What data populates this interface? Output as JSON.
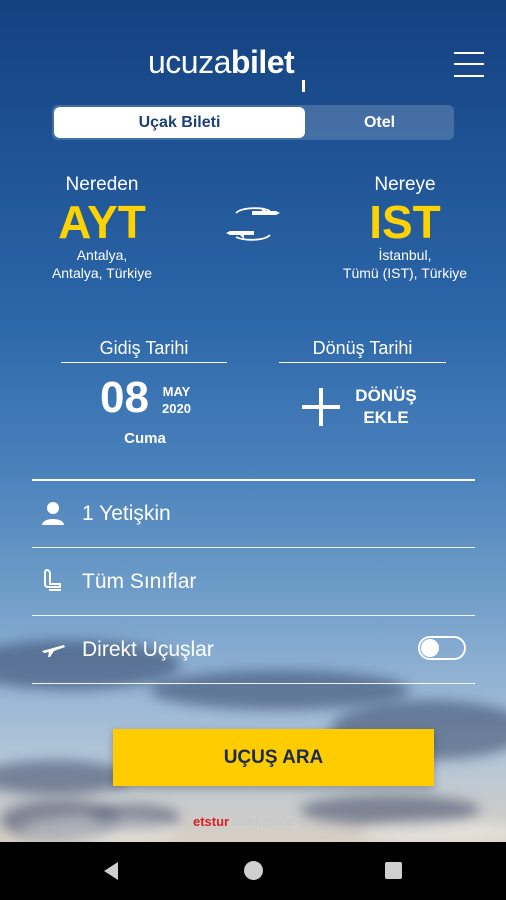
{
  "header": {
    "logo_thin": "ucuza",
    "logo_bold": "bilet",
    "menu_icon": "hamburger-menu-icon"
  },
  "tabs": [
    {
      "label": "Uçak Bileti",
      "active": true
    },
    {
      "label": "Otel",
      "active": false
    }
  ],
  "origin": {
    "label": "Nereden",
    "code": "AYT",
    "line1": "Antalya,",
    "line2": "Antalya, Türkiye"
  },
  "destination": {
    "label": "Nereye",
    "code": "IST",
    "line1": "İstanbul,",
    "line2": "Tümü (IST), Türkiye"
  },
  "swap_icon": "swap-planes-icon",
  "departure": {
    "label": "Gidiş Tarihi",
    "day": "08",
    "month": "MAY",
    "year": "2020",
    "weekday": "Cuma"
  },
  "return": {
    "label": "Dönüş Tarihi",
    "add_line1": "DÖNÜŞ",
    "add_line2": "EKLE"
  },
  "passengers": {
    "icon": "person-icon",
    "text": "1 Yetişkin"
  },
  "cabin": {
    "icon": "seat-icon",
    "text": "Tüm Sınıflar"
  },
  "direct": {
    "icon": "plane-icon",
    "text": "Direkt Uçuşlar",
    "enabled": false
  },
  "search_button": "UÇUŞ ARA",
  "footer": {
    "brand_red": "etstur",
    "brand_rest": " markasıdır"
  },
  "colors": {
    "accent_yellow": "#ffcc00",
    "code_yellow": "#ffd200",
    "tab_text": "#1d3f78"
  }
}
